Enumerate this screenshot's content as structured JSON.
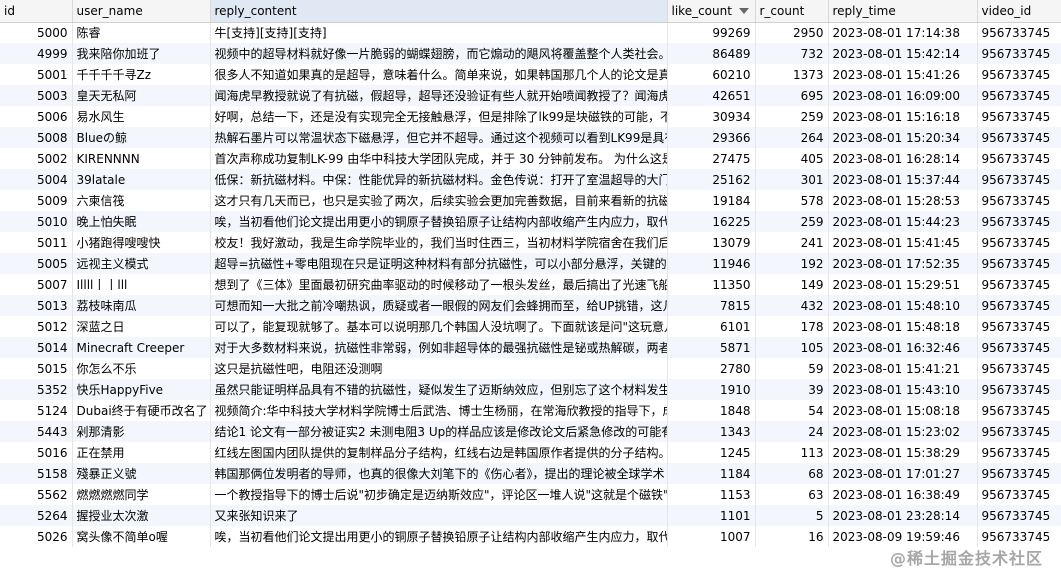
{
  "columns": [
    "id",
    "user_name",
    "reply_content",
    "like_count",
    "r_count",
    "reply_time",
    "video_id"
  ],
  "sorted_column": "like_count",
  "rows": [
    {
      "id": "5000",
      "user_name": "陈睿",
      "reply_content": "牛[支持][支持][支持]",
      "like_count": "99269",
      "r_count": "2950",
      "reply_time": "2023-08-01 17:14:38",
      "video_id": "956733745"
    },
    {
      "id": "4999",
      "user_name": "我来陪你加班了",
      "reply_content": "视频中的超导材料就好像一片脆弱的蝴蝶翅膀，而它煽动的飓风将覆盖整个人类社会。",
      "like_count": "86489",
      "r_count": "732",
      "reply_time": "2023-08-01 15:42:14",
      "video_id": "956733745"
    },
    {
      "id": "5001",
      "user_name": "千千千千寻Zz",
      "reply_content": "很多人不知道如果真的是超导，意味着什么。简单来说，如果韩国那几个人的论文是真",
      "like_count": "60210",
      "r_count": "1373",
      "reply_time": "2023-08-01 15:41:26",
      "video_id": "956733745"
    },
    {
      "id": "5003",
      "user_name": "皇天无私阿",
      "reply_content": "闻海虎早教授就说了有抗磁，假超导，超导还没验证有些人就开始喷闻教授了？闻海虎",
      "like_count": "42651",
      "r_count": "695",
      "reply_time": "2023-08-01 16:09:00",
      "video_id": "956733745"
    },
    {
      "id": "5006",
      "user_name": "易水风生",
      "reply_content": "好啊，总结一下，还是没有实现完全无接触悬浮，但是排除了lk99是块磁铁的可能，不",
      "like_count": "30934",
      "r_count": "259",
      "reply_time": "2023-08-01 15:16:18",
      "video_id": "956733745"
    },
    {
      "id": "5008",
      "user_name": "Blueの鲸",
      "reply_content": "热解石墨片可以常温状态下磁悬浮，但它并不超导。通过这个视频可以看到LK99是具有",
      "like_count": "29366",
      "r_count": "264",
      "reply_time": "2023-08-01 15:20:34",
      "video_id": "956733745"
    },
    {
      "id": "5002",
      "user_name": "KIRENNNN",
      "reply_content": "首次声称成功复制LK-99 由华中科技大学团队完成，并于 30 分钟前发布。 为什么这是",
      "like_count": "27475",
      "r_count": "405",
      "reply_time": "2023-08-01 16:28:14",
      "video_id": "956733745"
    },
    {
      "id": "5004",
      "user_name": "39latale",
      "reply_content": "低保：新抗磁材料。中保：性能优异的新抗磁材料。金色传说：打开了室温超导的大门",
      "like_count": "25162",
      "r_count": "301",
      "reply_time": "2023-08-01 15:37:44",
      "video_id": "956733745"
    },
    {
      "id": "5009",
      "user_name": "六柬信筏",
      "reply_content": "这才只有几天而已，也只是实验了两次，后续实验会更加完善数据，目前来看新的抗磁",
      "like_count": "19184",
      "r_count": "578",
      "reply_time": "2023-08-01 15:28:53",
      "video_id": "956733745"
    },
    {
      "id": "5010",
      "user_name": "晚上怕失眠",
      "reply_content": "唉，当初看他们论文提出用更小的铜原子替换铅原子让结构内部收缩产生内应力，取代",
      "like_count": "16225",
      "r_count": "259",
      "reply_time": "2023-08-01 15:44:23",
      "video_id": "956733745"
    },
    {
      "id": "5011",
      "user_name": "小猪跑得嗖嗖快",
      "reply_content": "校友！我好激动，我是生命学院毕业的，我们当时住西三，当初材料学院宿舍在我们后",
      "like_count": "13079",
      "r_count": "241",
      "reply_time": "2023-08-01 15:41:45",
      "video_id": "956733745"
    },
    {
      "id": "5005",
      "user_name": "远视主义模式",
      "reply_content": "超导=抗磁性+零电阻现在只是证明这种材料有部分抗磁性，可以小部分悬浮，关键的是",
      "like_count": "11946",
      "r_count": "192",
      "reply_time": "2023-08-01 17:52:35",
      "video_id": "956733745"
    },
    {
      "id": "5007",
      "user_name": "Illll丨丨lll",
      "reply_content": "想到了《三体》里面最初研究曲率驱动的时候移动了一根头发丝，最后搞出了光速飞船",
      "like_count": "11350",
      "r_count": "149",
      "reply_time": "2023-08-01 15:29:51",
      "video_id": "956733745"
    },
    {
      "id": "5013",
      "user_name": "荔枝味南瓜",
      "reply_content": "可想而知一大批之前冷嘲热讽，质疑或者一眼假的网友们会蜂拥而至，给UP挑错，这几",
      "like_count": "7815",
      "r_count": "432",
      "reply_time": "2023-08-01 15:48:10",
      "video_id": "956733745"
    },
    {
      "id": "5012",
      "user_name": "深蓝之日",
      "reply_content": "可以了，能复现就够了。基本可以说明那几个韩国人没坑啊了。下面就该是问\"这玩意儿",
      "like_count": "6101",
      "r_count": "178",
      "reply_time": "2023-08-01 15:48:18",
      "video_id": "956733745"
    },
    {
      "id": "5014",
      "user_name": "Minecraft Creeper",
      "reply_content": "对于大多数材料来说，抗磁性非常弱，例如非超导体的最强抗磁性是铋或热解碳，两者",
      "like_count": "5871",
      "r_count": "105",
      "reply_time": "2023-08-01 16:32:46",
      "video_id": "956733745"
    },
    {
      "id": "5015",
      "user_name": "你怎么不乐",
      "reply_content": "这只是抗磁性吧，电阻还没测啊",
      "like_count": "2780",
      "r_count": "59",
      "reply_time": "2023-08-01 15:41:21",
      "video_id": "956733745"
    },
    {
      "id": "5352",
      "user_name": "快乐HappyFive",
      "reply_content": "虽然只能证明样品具有不错的抗磁性，疑似发生了迈斯纳效应，但别忘了这个材料发生",
      "like_count": "1910",
      "r_count": "39",
      "reply_time": "2023-08-01 15:43:10",
      "video_id": "956733745"
    },
    {
      "id": "5124",
      "user_name": "Dubai终于有硬币改名了",
      "reply_content": "视频简介:华中科技大学材料学院博士后武浩、博士生杨丽，在常海欣教授的指导下，成",
      "like_count": "1848",
      "r_count": "54",
      "reply_time": "2023-08-01 15:08:18",
      "video_id": "956733745"
    },
    {
      "id": "5443",
      "user_name": "剁那清影",
      "reply_content": "结论1 论文有一部分被证实2 未测电阻3 Up的样品应该是修改论文后紧急修改的可能有",
      "like_count": "1343",
      "r_count": "24",
      "reply_time": "2023-08-01 15:23:02",
      "video_id": "956733745"
    },
    {
      "id": "5016",
      "user_name": "正在禁用",
      "reply_content": "红线左图国内团队提供的复制样品分子结构，红线右边是韩国原作者提供的分子结构。",
      "like_count": "1245",
      "r_count": "113",
      "reply_time": "2023-08-01 15:38:29",
      "video_id": "956733745"
    },
    {
      "id": "5158",
      "user_name": "殘暴正义號",
      "reply_content": "韩国那俩位发明者的导师，也真的很像大刘笔下的《伤心者》，提出的理论被全球学术",
      "like_count": "1184",
      "r_count": "68",
      "reply_time": "2023-08-01 17:01:27",
      "video_id": "956733745"
    },
    {
      "id": "5562",
      "user_name": "燃燃燃燃同学",
      "reply_content": "一个教授指导下的博士后说\"初步确定是迈纳斯效应\"，评论区一堆人说\"这就是个磁铁\"",
      "like_count": "1153",
      "r_count": "63",
      "reply_time": "2023-08-01 16:38:49",
      "video_id": "956733745"
    },
    {
      "id": "5264",
      "user_name": "握授业太次激",
      "reply_content": "又来张知识来了",
      "like_count": "1101",
      "r_count": "5",
      "reply_time": "2023-08-01 23:28:14",
      "video_id": "956733745"
    },
    {
      "id": "5026",
      "user_name": "窝头像不简单o喔",
      "reply_content": "唉，当初看他们论文提出用更小的铜原子替换铅原子让结构内部收缩产生内应力，取代",
      "like_count": "1007",
      "r_count": "16",
      "reply_time": "2023-08-09 19:59:46",
      "video_id": "956733745"
    }
  ],
  "watermark": "@稀土掘金技术社区"
}
